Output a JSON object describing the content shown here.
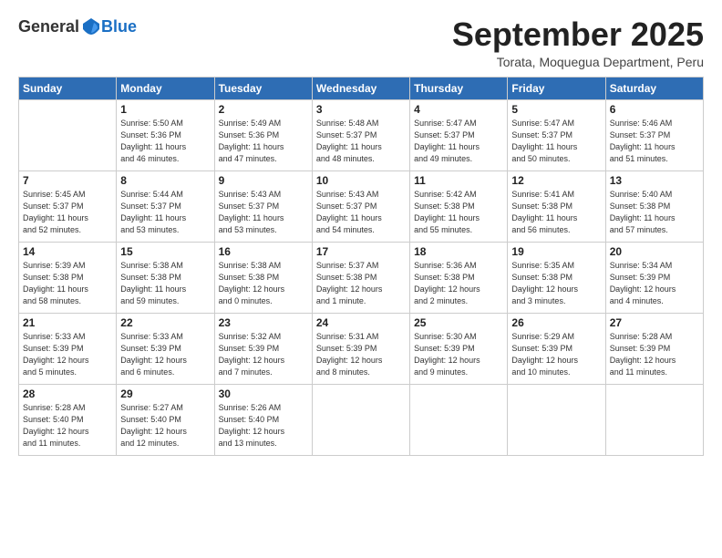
{
  "logo": {
    "general": "General",
    "blue": "Blue"
  },
  "title": "September 2025",
  "subtitle": "Torata, Moquegua Department, Peru",
  "days_of_week": [
    "Sunday",
    "Monday",
    "Tuesday",
    "Wednesday",
    "Thursday",
    "Friday",
    "Saturday"
  ],
  "weeks": [
    [
      {
        "day": "",
        "sunrise": "",
        "sunset": "",
        "daylight": ""
      },
      {
        "day": "1",
        "sunrise": "Sunrise: 5:50 AM",
        "sunset": "Sunset: 5:36 PM",
        "daylight": "Daylight: 11 hours and 46 minutes."
      },
      {
        "day": "2",
        "sunrise": "Sunrise: 5:49 AM",
        "sunset": "Sunset: 5:36 PM",
        "daylight": "Daylight: 11 hours and 47 minutes."
      },
      {
        "day": "3",
        "sunrise": "Sunrise: 5:48 AM",
        "sunset": "Sunset: 5:37 PM",
        "daylight": "Daylight: 11 hours and 48 minutes."
      },
      {
        "day": "4",
        "sunrise": "Sunrise: 5:47 AM",
        "sunset": "Sunset: 5:37 PM",
        "daylight": "Daylight: 11 hours and 49 minutes."
      },
      {
        "day": "5",
        "sunrise": "Sunrise: 5:47 AM",
        "sunset": "Sunset: 5:37 PM",
        "daylight": "Daylight: 11 hours and 50 minutes."
      },
      {
        "day": "6",
        "sunrise": "Sunrise: 5:46 AM",
        "sunset": "Sunset: 5:37 PM",
        "daylight": "Daylight: 11 hours and 51 minutes."
      }
    ],
    [
      {
        "day": "7",
        "sunrise": "Sunrise: 5:45 AM",
        "sunset": "Sunset: 5:37 PM",
        "daylight": "Daylight: 11 hours and 52 minutes."
      },
      {
        "day": "8",
        "sunrise": "Sunrise: 5:44 AM",
        "sunset": "Sunset: 5:37 PM",
        "daylight": "Daylight: 11 hours and 53 minutes."
      },
      {
        "day": "9",
        "sunrise": "Sunrise: 5:43 AM",
        "sunset": "Sunset: 5:37 PM",
        "daylight": "Daylight: 11 hours and 53 minutes."
      },
      {
        "day": "10",
        "sunrise": "Sunrise: 5:43 AM",
        "sunset": "Sunset: 5:37 PM",
        "daylight": "Daylight: 11 hours and 54 minutes."
      },
      {
        "day": "11",
        "sunrise": "Sunrise: 5:42 AM",
        "sunset": "Sunset: 5:38 PM",
        "daylight": "Daylight: 11 hours and 55 minutes."
      },
      {
        "day": "12",
        "sunrise": "Sunrise: 5:41 AM",
        "sunset": "Sunset: 5:38 PM",
        "daylight": "Daylight: 11 hours and 56 minutes."
      },
      {
        "day": "13",
        "sunrise": "Sunrise: 5:40 AM",
        "sunset": "Sunset: 5:38 PM",
        "daylight": "Daylight: 11 hours and 57 minutes."
      }
    ],
    [
      {
        "day": "14",
        "sunrise": "Sunrise: 5:39 AM",
        "sunset": "Sunset: 5:38 PM",
        "daylight": "Daylight: 11 hours and 58 minutes."
      },
      {
        "day": "15",
        "sunrise": "Sunrise: 5:38 AM",
        "sunset": "Sunset: 5:38 PM",
        "daylight": "Daylight: 11 hours and 59 minutes."
      },
      {
        "day": "16",
        "sunrise": "Sunrise: 5:38 AM",
        "sunset": "Sunset: 5:38 PM",
        "daylight": "Daylight: 12 hours and 0 minutes."
      },
      {
        "day": "17",
        "sunrise": "Sunrise: 5:37 AM",
        "sunset": "Sunset: 5:38 PM",
        "daylight": "Daylight: 12 hours and 1 minute."
      },
      {
        "day": "18",
        "sunrise": "Sunrise: 5:36 AM",
        "sunset": "Sunset: 5:38 PM",
        "daylight": "Daylight: 12 hours and 2 minutes."
      },
      {
        "day": "19",
        "sunrise": "Sunrise: 5:35 AM",
        "sunset": "Sunset: 5:38 PM",
        "daylight": "Daylight: 12 hours and 3 minutes."
      },
      {
        "day": "20",
        "sunrise": "Sunrise: 5:34 AM",
        "sunset": "Sunset: 5:39 PM",
        "daylight": "Daylight: 12 hours and 4 minutes."
      }
    ],
    [
      {
        "day": "21",
        "sunrise": "Sunrise: 5:33 AM",
        "sunset": "Sunset: 5:39 PM",
        "daylight": "Daylight: 12 hours and 5 minutes."
      },
      {
        "day": "22",
        "sunrise": "Sunrise: 5:33 AM",
        "sunset": "Sunset: 5:39 PM",
        "daylight": "Daylight: 12 hours and 6 minutes."
      },
      {
        "day": "23",
        "sunrise": "Sunrise: 5:32 AM",
        "sunset": "Sunset: 5:39 PM",
        "daylight": "Daylight: 12 hours and 7 minutes."
      },
      {
        "day": "24",
        "sunrise": "Sunrise: 5:31 AM",
        "sunset": "Sunset: 5:39 PM",
        "daylight": "Daylight: 12 hours and 8 minutes."
      },
      {
        "day": "25",
        "sunrise": "Sunrise: 5:30 AM",
        "sunset": "Sunset: 5:39 PM",
        "daylight": "Daylight: 12 hours and 9 minutes."
      },
      {
        "day": "26",
        "sunrise": "Sunrise: 5:29 AM",
        "sunset": "Sunset: 5:39 PM",
        "daylight": "Daylight: 12 hours and 10 minutes."
      },
      {
        "day": "27",
        "sunrise": "Sunrise: 5:28 AM",
        "sunset": "Sunset: 5:39 PM",
        "daylight": "Daylight: 12 hours and 11 minutes."
      }
    ],
    [
      {
        "day": "28",
        "sunrise": "Sunrise: 5:28 AM",
        "sunset": "Sunset: 5:40 PM",
        "daylight": "Daylight: 12 hours and 11 minutes."
      },
      {
        "day": "29",
        "sunrise": "Sunrise: 5:27 AM",
        "sunset": "Sunset: 5:40 PM",
        "daylight": "Daylight: 12 hours and 12 minutes."
      },
      {
        "day": "30",
        "sunrise": "Sunrise: 5:26 AM",
        "sunset": "Sunset: 5:40 PM",
        "daylight": "Daylight: 12 hours and 13 minutes."
      },
      {
        "day": "",
        "sunrise": "",
        "sunset": "",
        "daylight": ""
      },
      {
        "day": "",
        "sunrise": "",
        "sunset": "",
        "daylight": ""
      },
      {
        "day": "",
        "sunrise": "",
        "sunset": "",
        "daylight": ""
      },
      {
        "day": "",
        "sunrise": "",
        "sunset": "",
        "daylight": ""
      }
    ]
  ]
}
